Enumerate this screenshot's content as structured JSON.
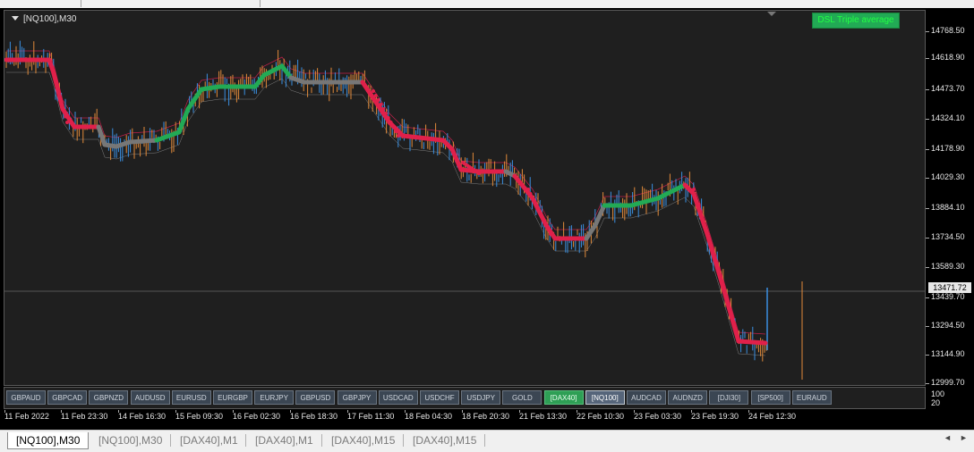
{
  "chart": {
    "symbol_label": "[NQ100],M30",
    "indicator_label": "DSL Triple average",
    "current_price": "13471.72",
    "y_ticks": [
      "14768.50",
      "14618.90",
      "14473.70",
      "14324.10",
      "14178.90",
      "14029.30",
      "13884.10",
      "13734.50",
      "13589.30",
      "13439.70",
      "13294.50",
      "13144.90",
      "12999.70"
    ],
    "sub_y_ticks": [
      "100",
      "20"
    ],
    "x_ticks": [
      "11 Feb 2022",
      "11 Feb 23:30",
      "14 Feb 16:30",
      "15 Feb 09:30",
      "16 Feb 02:30",
      "16 Feb 18:30",
      "17 Feb 11:30",
      "18 Feb 04:30",
      "18 Feb 20:30",
      "21 Feb 13:30",
      "22 Feb 10:30",
      "23 Feb 03:30",
      "23 Feb 19:30",
      "24 Feb 12:30"
    ],
    "colors": {
      "background": "#1f1f1f",
      "bull_bar": "#3a8fe0",
      "bear_bar": "#e08a3a",
      "down_line": "#e0204a",
      "up_line": "#22aa55",
      "neutral_line": "#777777"
    }
  },
  "symbol_buttons": [
    {
      "label": "GBPAUD"
    },
    {
      "label": "GBPCAD"
    },
    {
      "label": "GBPNZD"
    },
    {
      "label": "AUDUSD"
    },
    {
      "label": "EURUSD"
    },
    {
      "label": "EURGBP"
    },
    {
      "label": "EURJPY"
    },
    {
      "label": "GBPUSD"
    },
    {
      "label": "GBPJPY"
    },
    {
      "label": "USDCAD"
    },
    {
      "label": "USDCHF"
    },
    {
      "label": "USDJPY"
    },
    {
      "label": "GOLD"
    },
    {
      "label": "[DAX40]"
    },
    {
      "label": "[NQ100]"
    },
    {
      "label": "AUDCAD"
    },
    {
      "label": "AUDNZD"
    },
    {
      "label": "[DJI30]"
    },
    {
      "label": "[SP500]"
    },
    {
      "label": "EURAUD"
    }
  ],
  "tabs": [
    {
      "label": "[NQ100],M30"
    },
    {
      "label": "[NQ100],M30"
    },
    {
      "label": "[DAX40],M1"
    },
    {
      "label": "[DAX40],M1"
    },
    {
      "label": "[DAX40],M15"
    },
    {
      "label": "[DAX40],M15"
    }
  ],
  "scroll": {
    "left": "◄",
    "right": "►"
  }
}
